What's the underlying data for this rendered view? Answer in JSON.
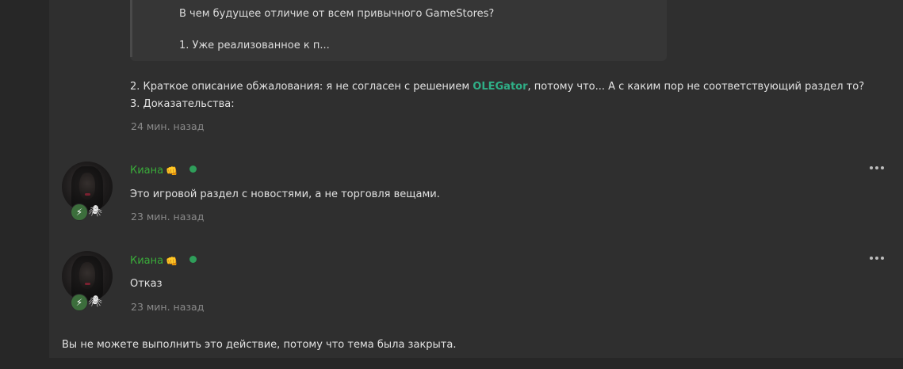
{
  "quote": {
    "line1": "В чем будущее отличие от всем привычного GameStores?",
    "line2": "1. Уже реализованное к п..."
  },
  "post_top": {
    "line1_before": "2. Краткое описание обжалования: я не согласен с решением ",
    "mention": "OLEGator",
    "line1_after": ", потому что... А с каким пор не соответствующий раздел то?",
    "line2": "3. Доказательства:",
    "time": "24 мин. назад"
  },
  "posts": [
    {
      "username": "Киана",
      "message": "Это игровой раздел с новостями, а не торговля вещами.",
      "time": "23 мин. назад",
      "icons": [
        "fist-icon",
        "online-status-icon",
        "bolt-badge-icon",
        "spider-badge-icon",
        "more-options-icon"
      ]
    },
    {
      "username": "Киана",
      "message": "Отказ",
      "time": "23 мин. назад",
      "icons": [
        "fist-icon",
        "online-status-icon",
        "bolt-badge-icon",
        "spider-badge-icon",
        "more-options-icon"
      ]
    }
  ],
  "closed_notice": "Вы не можете выполнить это действие, потому что тема была закрыта.",
  "colors": {
    "username": "#3aab3a",
    "mention": "#2fae86",
    "online": "#2f9e5a",
    "badge_bolt": "#3c6e3c"
  }
}
